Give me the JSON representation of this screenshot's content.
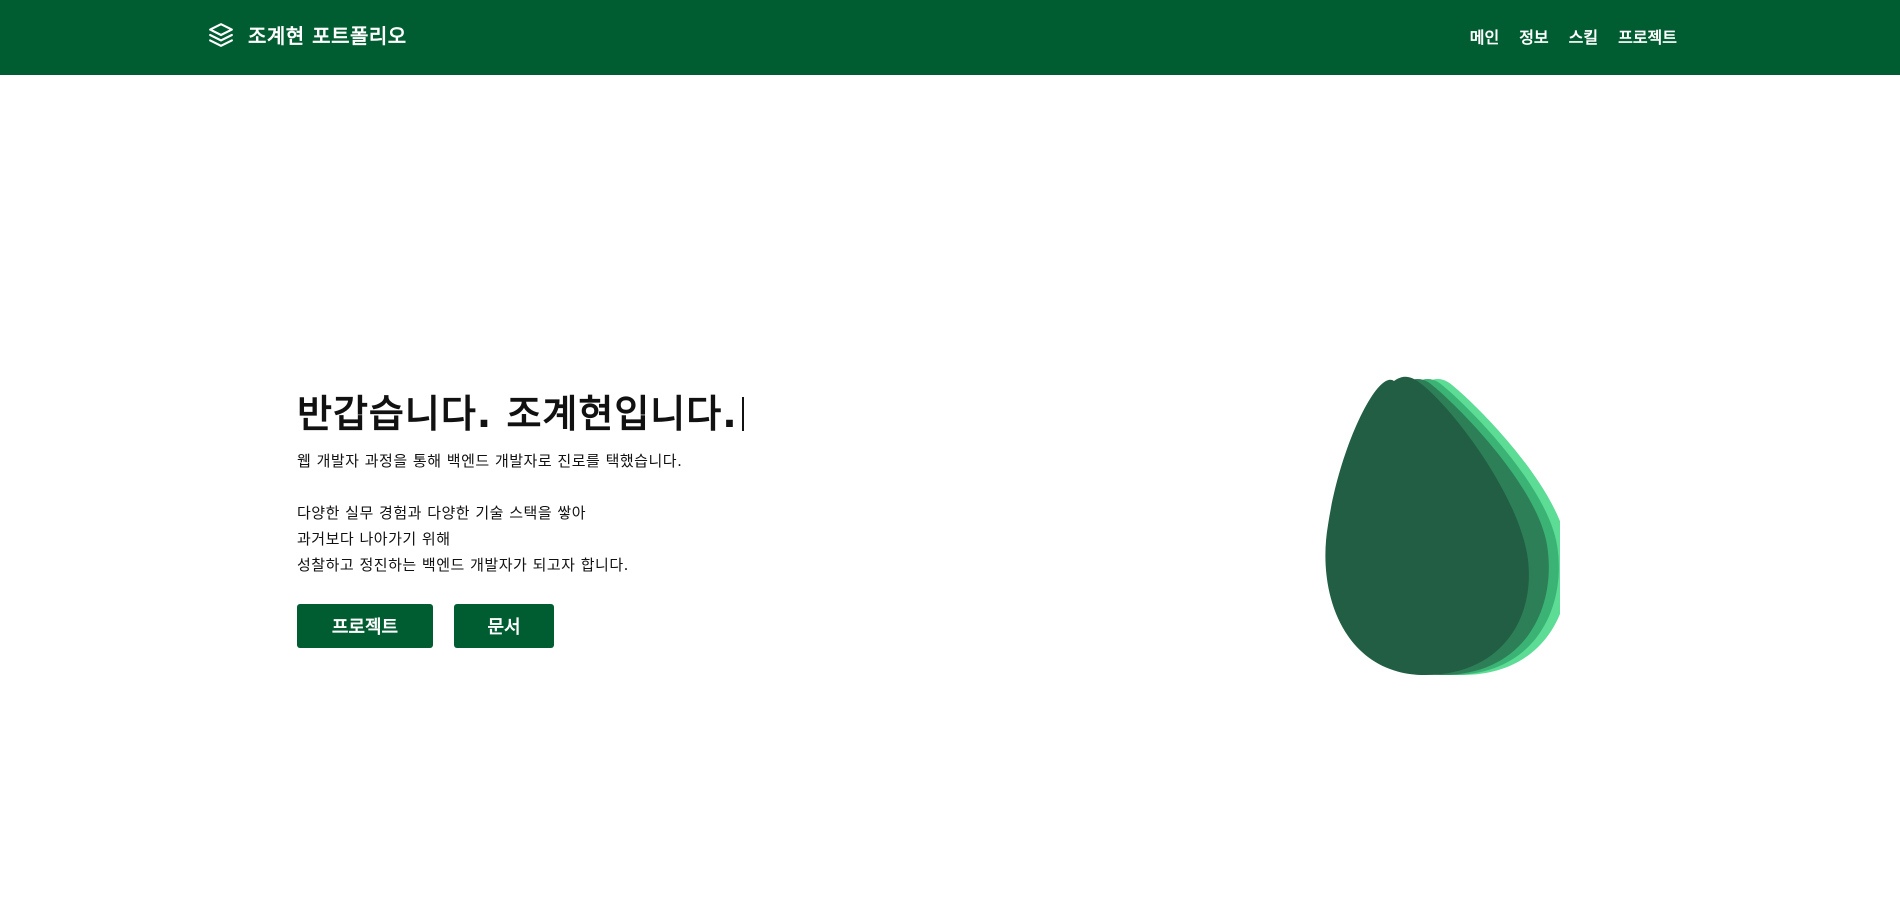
{
  "colors": {
    "brand": "#005c31",
    "drop_back": "#5cdc94",
    "drop_mid2": "#3bb374",
    "drop_mid1": "#2d7f57",
    "drop_front": "#215e44"
  },
  "header": {
    "logo_icon": "layers-icon",
    "title": "조계현 포트폴리오",
    "nav": [
      {
        "label": "메인"
      },
      {
        "label": "정보"
      },
      {
        "label": "스킬"
      },
      {
        "label": "프로젝트"
      }
    ]
  },
  "hero": {
    "title": "반갑습니다. 조계현입니다.",
    "intro": "웹 개발자 과정을 통해 백엔드 개발자로 진로를 택했습니다.",
    "lines": [
      "다양한 실무 경험과 다양한 기술 스택을 쌓아",
      "과거보다 나아가기 위해",
      "성찰하고 정진하는 백엔드 개발자가 되고자 합니다."
    ],
    "buttons": {
      "projects": "프로젝트",
      "docs": "문서"
    }
  },
  "illustration": {
    "icon": "water-drop-layers-icon"
  }
}
